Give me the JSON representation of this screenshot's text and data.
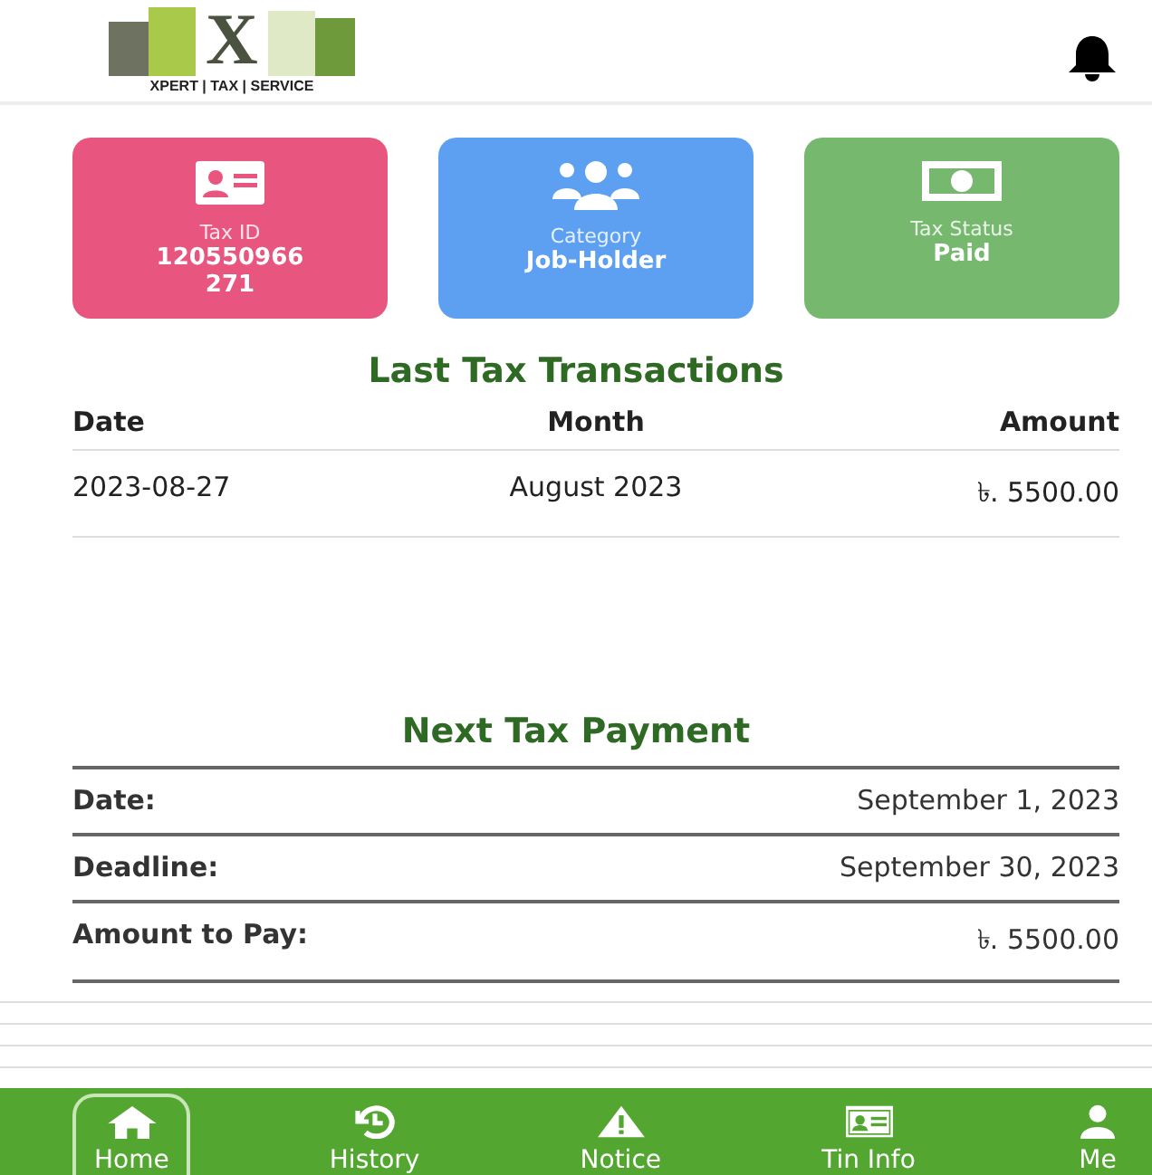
{
  "header": {
    "logo_letter": "X",
    "logo_caption": "XPERT | TAX | SERVICE"
  },
  "cards": [
    {
      "kind": "id",
      "label": "Tax ID",
      "value": "120550966\n271",
      "color": "#e8557f"
    },
    {
      "kind": "people",
      "label": "Category",
      "value": "Job-Holder",
      "color": "#5d9ff0"
    },
    {
      "kind": "money",
      "label": "Tax Status",
      "value": "Paid",
      "color": "#76b86e"
    }
  ],
  "last_transactions": {
    "title": "Last Tax Transactions",
    "columns": [
      "Date",
      "Month",
      "Amount"
    ],
    "rows": [
      [
        "2023-08-27",
        "August 2023",
        "৳. 5500.00"
      ]
    ]
  },
  "next_payment": {
    "title": "Next Tax Payment",
    "rows": [
      {
        "label": "Date:",
        "value": "September 1, 2023"
      },
      {
        "label": "Deadline:",
        "value": "September 30, 2023"
      },
      {
        "label": "Amount to Pay:",
        "value": "৳. 5500.00"
      }
    ]
  },
  "nav": [
    {
      "kind": "home",
      "label": "Home",
      "selected": true
    },
    {
      "kind": "history",
      "label": "History",
      "selected": false
    },
    {
      "kind": "notice",
      "label": "Notice",
      "selected": false
    },
    {
      "kind": "tin",
      "label": "Tin Info",
      "selected": false
    },
    {
      "kind": "me",
      "label": "Me",
      "selected": false
    }
  ]
}
